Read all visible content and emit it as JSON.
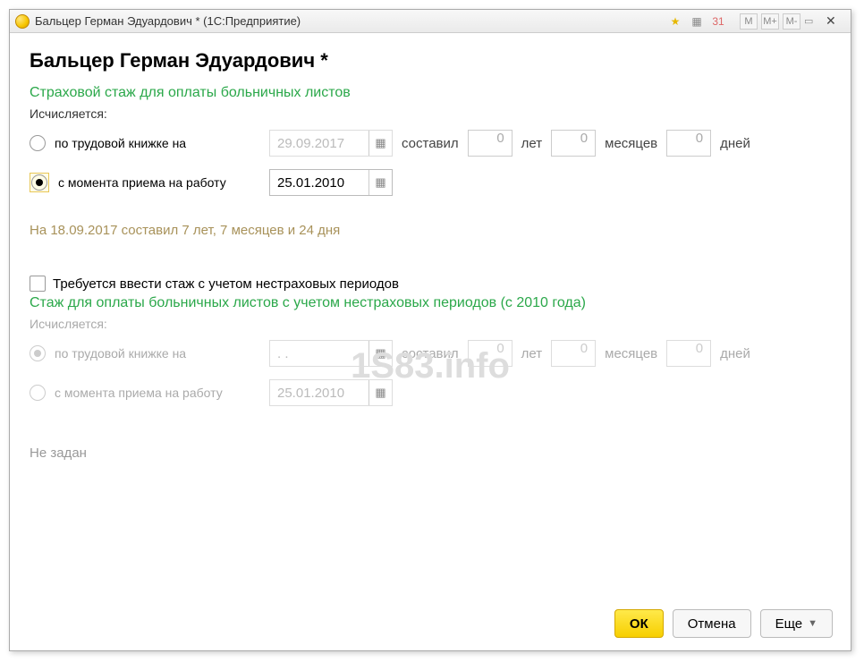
{
  "titlebar": {
    "title": "Бальцер Герман Эдуардович * (1С:Предприятие)",
    "logo": "1С",
    "btns": {
      "m": "M",
      "mplus": "M+",
      "mminus": "M-"
    }
  },
  "header": "Бальцер Герман Эдуардович *",
  "section1": {
    "title": "Страховой стаж для оплаты больничных листов",
    "calc_label": "Исчисляется:",
    "opt1": {
      "label": "по трудовой книжке на",
      "date": "29.09.2017",
      "composed": "составил",
      "years": "0",
      "ylabel": "лет",
      "months": "0",
      "mlabel": "месяцев",
      "days": "0",
      "dlabel": "дней"
    },
    "opt2": {
      "label": "с момента приема на работу",
      "date": "25.01.2010"
    },
    "info": "На 18.09.2017 составил 7 лет, 7 месяцев и 24 дня"
  },
  "watermark": "1S83.info",
  "checkbox": {
    "label": "Требуется ввести стаж с учетом нестраховых периодов"
  },
  "section2": {
    "title": "Стаж для оплаты больничных листов с учетом нестраховых периодов (с 2010 года)",
    "calc_label": "Исчисляется:",
    "opt1": {
      "label": "по трудовой книжке на",
      "date": "  .  .    ",
      "composed": "составил",
      "years": "0",
      "ylabel": "лет",
      "months": "0",
      "mlabel": "месяцев",
      "days": "0",
      "dlabel": "дней"
    },
    "opt2": {
      "label": "с момента приема на работу",
      "date": "25.01.2010"
    },
    "not_set": "Не задан"
  },
  "footer": {
    "ok": "ОК",
    "cancel": "Отмена",
    "more": "Еще"
  }
}
